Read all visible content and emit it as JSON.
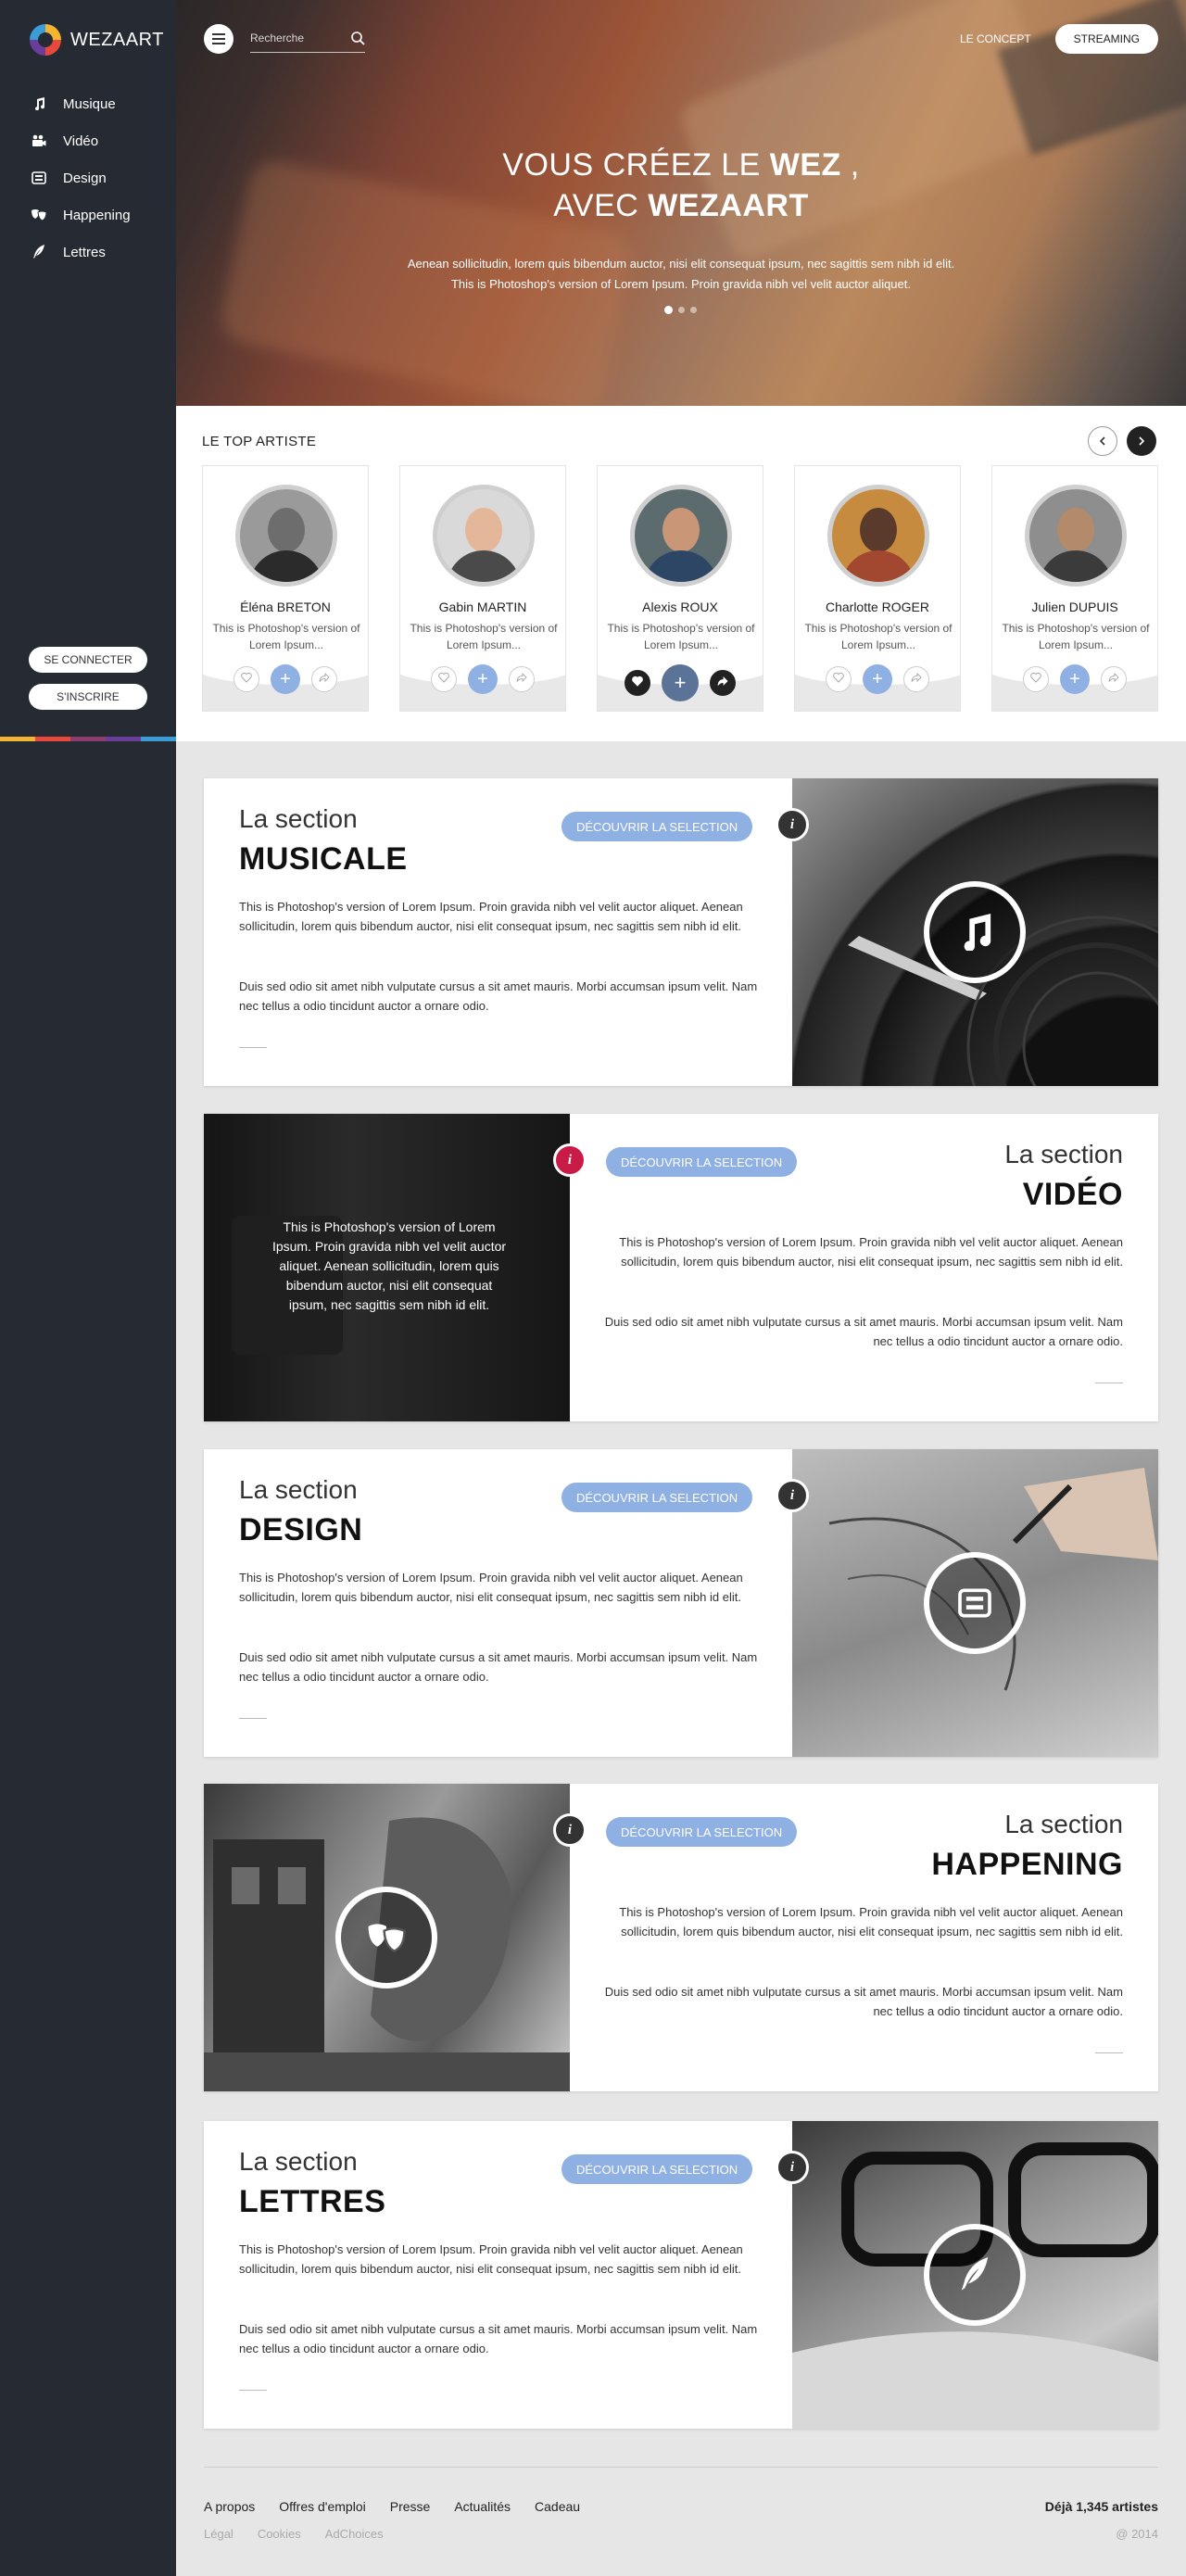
{
  "brand": {
    "name": "WEZAART"
  },
  "sidebar": {
    "items": [
      {
        "label": "Musique",
        "icon": "music-note-icon"
      },
      {
        "label": "Vidéo",
        "icon": "video-camera-icon"
      },
      {
        "label": "Design",
        "icon": "design-icon"
      },
      {
        "label": "Happening",
        "icon": "masks-icon"
      },
      {
        "label": "Lettres",
        "icon": "quill-icon"
      }
    ],
    "connect_label": "SE CONNECTER",
    "signup_label": "S'INSCRIRE",
    "color_strip": [
      "#f3b431",
      "#e74a3b",
      "#8e3b6e",
      "#6a3d9a",
      "#3a9dd8"
    ]
  },
  "header": {
    "search_placeholder": "Recherche",
    "concept_label": "LE CONCEPT",
    "streaming_label": "STREAMING"
  },
  "hero": {
    "title_line1_a": "VOUS CRÉEZ LE ",
    "title_line1_b": "WEZ",
    "title_line1_c": " ,",
    "title_line2_a": "AVEC ",
    "title_line2_b": "WEZAART",
    "text_line1": "Aenean sollicitudin, lorem quis bibendum auctor, nisi elit consequat ipsum, nec sagittis sem nibh id elit.",
    "text_line2": "This is Photoshop's version  of Lorem Ipsum. Proin gravida nibh vel velit auctor aliquet.",
    "slide_count": 3,
    "active_slide": 1
  },
  "top_artists": {
    "title": "LE TOP ARTISTE",
    "artists": [
      {
        "name": "Éléna BRETON",
        "desc": "This is Photoshop's version of Lorem Ipsum...",
        "skin": "#6d6d6d",
        "shirt": "#2b2b2b",
        "bg": "#9a9a9a"
      },
      {
        "name": "Gabin MARTIN",
        "desc": "This is Photoshop's version of Lorem Ipsum...",
        "skin": "#e5b79a",
        "shirt": "#4a4a4a",
        "bg": "#d9d9d9"
      },
      {
        "name": "Alexis ROUX",
        "desc": "This is Photoshop's version of Lorem Ipsum...",
        "skin": "#c99777",
        "shirt": "#2d4666",
        "bg": "#5c6b6e"
      },
      {
        "name": "Charlotte ROGER",
        "desc": "This is Photoshop's version of Lorem Ipsum...",
        "skin": "#5a3a2a",
        "shirt": "#a34830",
        "bg": "#c78b3f"
      },
      {
        "name": "Julien DUPUIS",
        "desc": "This is Photoshop's version of Lorem Ipsum...",
        "skin": "#b38a6a",
        "shirt": "#3b3b3b",
        "bg": "#8e8e8e"
      }
    ]
  },
  "sections": [
    {
      "label": "La section",
      "name": "MUSICALE",
      "button": "DÉCOUVRIR LA SELECTION",
      "icon": "music-note-icon",
      "p1": "This is Photoshop's version  of Lorem Ipsum. Proin gravida nibh vel velit auctor aliquet. Aenean sollicitudin, lorem quis bibendum auctor, nisi elit consequat ipsum, nec sagittis sem nibh id elit.",
      "p2": "Duis sed odio sit amet nibh vulputate cursus a sit amet mauris. Morbi accumsan ipsum velit. Nam nec tellus a odio tincidunt auctor a ornare odio."
    },
    {
      "label": "La section",
      "name": "VIDÉO",
      "button": "DÉCOUVRIR LA SELECTION",
      "icon": "video-camera-icon",
      "overlay": "This is Photoshop's version  of Lorem Ipsum. Proin gravida nibh vel velit auctor aliquet. Aenean sollicitudin, lorem quis bibendum auctor, nisi elit consequat ipsum, nec sagittis sem nibh id elit.",
      "p1": "This is Photoshop's version  of Lorem Ipsum. Proin gravida nibh vel velit auctor aliquet. Aenean sollicitudin, lorem quis bibendum auctor, nisi elit consequat ipsum, nec sagittis sem nibh id elit.",
      "p2": "Duis sed odio sit amet nibh vulputate cursus a sit amet mauris. Morbi accumsan ipsum velit. Nam nec tellus a odio tincidunt auctor a ornare odio."
    },
    {
      "label": "La section",
      "name": "DESIGN",
      "button": "DÉCOUVRIR LA SELECTION",
      "icon": "design-icon",
      "p1": "This is Photoshop's version  of Lorem Ipsum. Proin gravida nibh vel velit auctor aliquet. Aenean sollicitudin, lorem quis bibendum auctor, nisi elit consequat ipsum, nec sagittis sem nibh id elit.",
      "p2": "Duis sed odio sit amet nibh vulputate cursus a sit amet mauris. Morbi accumsan ipsum velit. Nam nec tellus a odio tincidunt auctor a ornare odio."
    },
    {
      "label": "La section",
      "name": "HAPPENING",
      "button": "DÉCOUVRIR LA SELECTION",
      "icon": "masks-icon",
      "p1": "This is Photoshop's version  of Lorem Ipsum. Proin gravida nibh vel velit auctor aliquet. Aenean sollicitudin, lorem quis bibendum auctor, nisi elit consequat ipsum, nec sagittis sem nibh id elit.",
      "p2": "Duis sed odio sit amet nibh vulputate cursus a sit amet mauris. Morbi accumsan ipsum velit. Nam nec tellus a odio tincidunt auctor a ornare odio."
    },
    {
      "label": "La section",
      "name": "LETTRES",
      "button": "DÉCOUVRIR LA SELECTION",
      "icon": "quill-icon",
      "p1": "This is Photoshop's version  of Lorem Ipsum. Proin gravida nibh vel velit auctor aliquet. Aenean sollicitudin, lorem quis bibendum auctor, nisi elit consequat ipsum, nec sagittis sem nibh id elit.",
      "p2": "Duis sed odio sit amet nibh vulputate cursus a sit amet mauris. Morbi accumsan ipsum velit. Nam nec tellus a odio tincidunt auctor a ornare odio."
    }
  ],
  "footer": {
    "links": [
      "A propos",
      "Offres d'emploi",
      "Presse",
      "Actualités",
      "Cadeau"
    ],
    "sub_links": [
      "Légal",
      "Cookies",
      "AdChoices"
    ],
    "count": "Déjà 1,345 artistes",
    "copyright": "@ 2014"
  },
  "colors": {
    "accent": "#8fb0e3",
    "sidebar": "#262b33",
    "info_red": "#c91b48"
  }
}
